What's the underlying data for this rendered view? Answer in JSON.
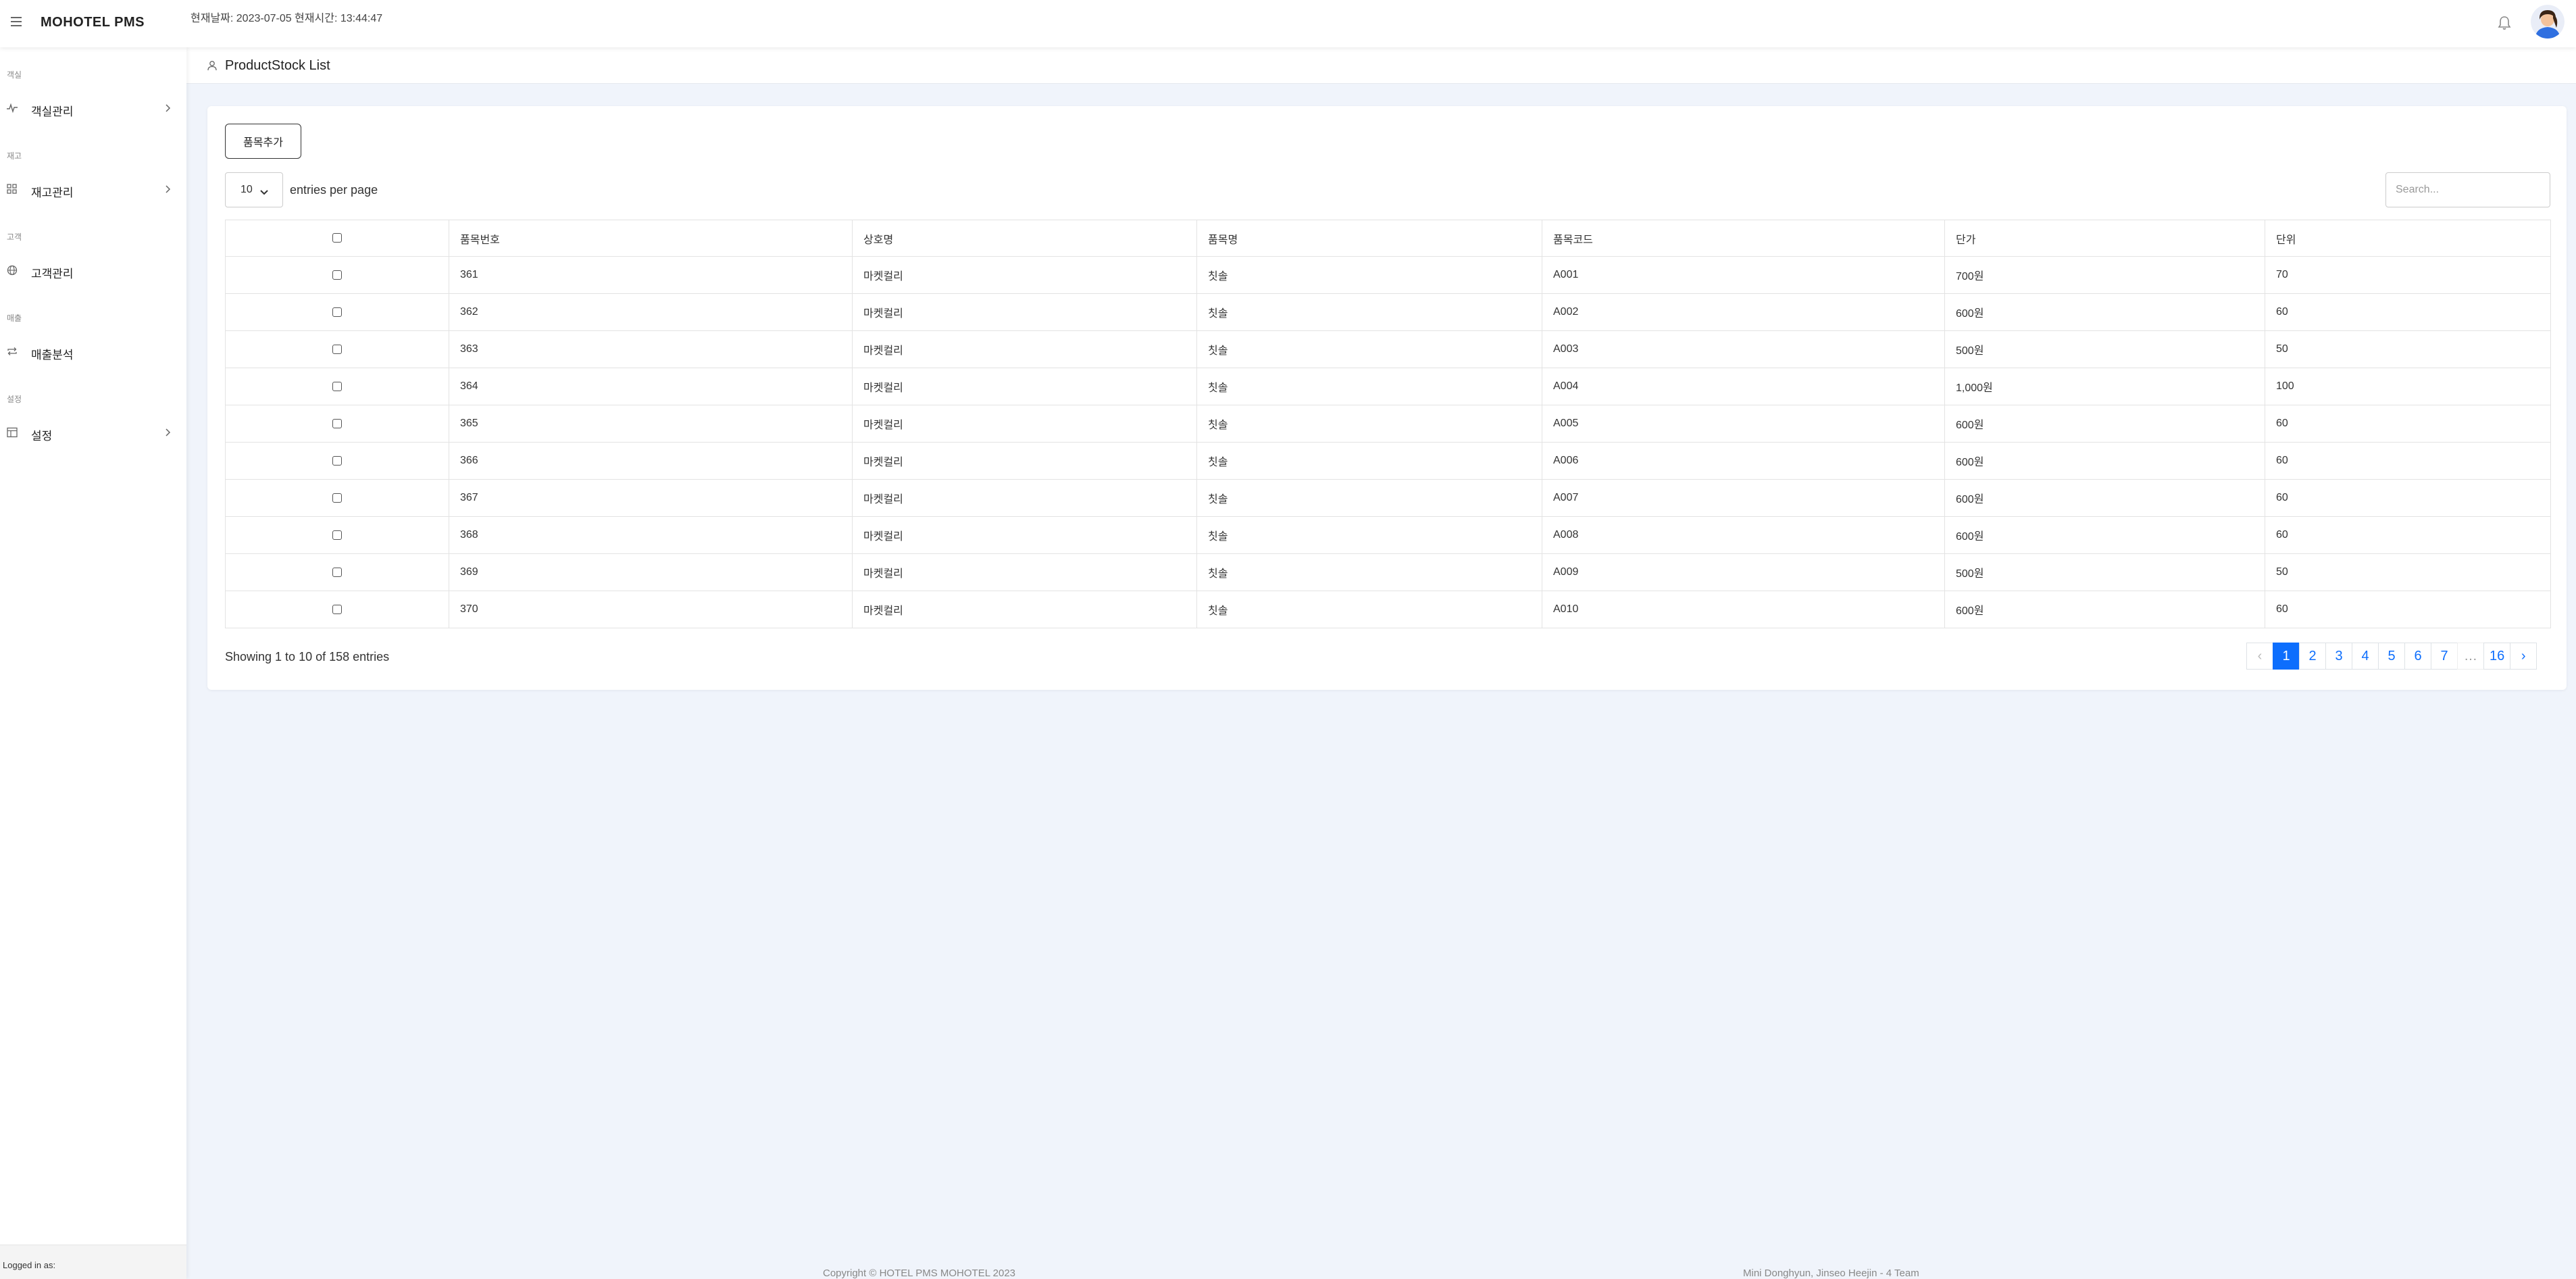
{
  "app": {
    "brand": "MOHOTEL PMS",
    "datetime": "현재날짜: 2023-07-05 현재시간: 13:44:47"
  },
  "sidebar": {
    "sections": [
      {
        "heading": "객실",
        "item": {
          "label": "객실관리",
          "icon": "activity-icon",
          "has_chevron": true
        }
      },
      {
        "heading": "재고",
        "item": {
          "label": "재고관리",
          "icon": "grid-icon",
          "has_chevron": true
        }
      },
      {
        "heading": "고객",
        "item": {
          "label": "고객관리",
          "icon": "globe-icon",
          "has_chevron": false
        }
      },
      {
        "heading": "매출",
        "item": {
          "label": "매출분석",
          "icon": "repeat-icon",
          "has_chevron": false
        }
      },
      {
        "heading": "설정",
        "item": {
          "label": "설정",
          "icon": "layout-icon",
          "has_chevron": true
        }
      }
    ],
    "logged_in": "Logged in as:"
  },
  "page": {
    "title": "ProductStock List",
    "title_icon": "user-icon"
  },
  "toolbar": {
    "add_label": "품목추가",
    "per_page_value": "10",
    "per_page_label": "entries per page",
    "search_placeholder": "Search..."
  },
  "table": {
    "headers": [
      "품목번호",
      "상호명",
      "품목명",
      "품목코드",
      "단가",
      "단위"
    ],
    "rows": [
      [
        "361",
        "마켓컬리",
        "칫솔",
        "A001",
        "700원",
        "70"
      ],
      [
        "362",
        "마켓컬리",
        "칫솔",
        "A002",
        "600원",
        "60"
      ],
      [
        "363",
        "마켓컬리",
        "칫솔",
        "A003",
        "500원",
        "50"
      ],
      [
        "364",
        "마켓컬리",
        "칫솔",
        "A004",
        "1,000원",
        "100"
      ],
      [
        "365",
        "마켓컬리",
        "칫솔",
        "A005",
        "600원",
        "60"
      ],
      [
        "366",
        "마켓컬리",
        "칫솔",
        "A006",
        "600원",
        "60"
      ],
      [
        "367",
        "마켓컬리",
        "칫솔",
        "A007",
        "600원",
        "60"
      ],
      [
        "368",
        "마켓컬리",
        "칫솔",
        "A008",
        "600원",
        "60"
      ],
      [
        "369",
        "마켓컬리",
        "칫솔",
        "A009",
        "500원",
        "50"
      ],
      [
        "370",
        "마켓컬리",
        "칫솔",
        "A010",
        "600원",
        "60"
      ]
    ]
  },
  "pagination": {
    "info": "Showing 1 to 10 of 158 entries",
    "prev": "‹",
    "next": "›",
    "pages": [
      "1",
      "2",
      "3",
      "4",
      "5",
      "6",
      "7",
      "…",
      "16"
    ],
    "active": "1"
  },
  "footer": {
    "left": "Copyright © HOTEL PMS MOHOTEL 2023",
    "right": "Mini Donghyun, Jinseo Heejin - 4 Team"
  },
  "colors": {
    "accent": "#0d6efd",
    "background": "#f0f4fb"
  }
}
